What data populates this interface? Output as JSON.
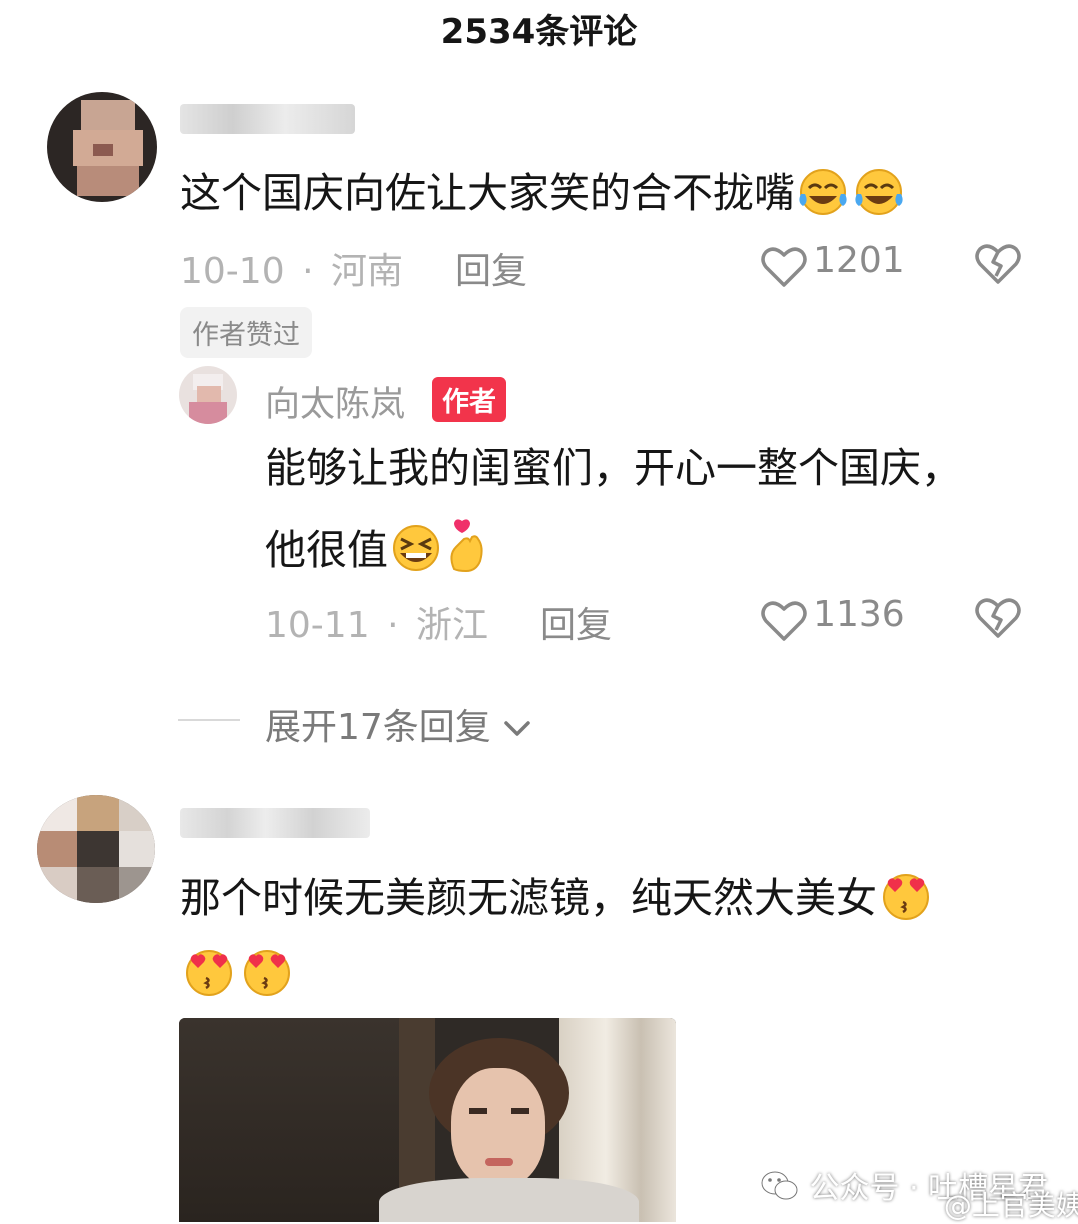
{
  "header": {
    "title": "2534条评论"
  },
  "comments": [
    {
      "text": "这个国庆向佐让大家笑的合不拢嘴",
      "date": "10-10",
      "sep": "·",
      "location": "河南",
      "reply_label": "回复",
      "likes": "1201",
      "author_liked_badge": "作者赞过",
      "emojis": [
        "laughing-tears-emoji",
        "laughing-tears-emoji"
      ]
    },
    {
      "text": "那个时候无美颜无滤镜，纯天然大美女",
      "emojis": [
        "heart-eyes-kiss-emoji",
        "heart-eyes-kiss-emoji",
        "heart-eyes-kiss-emoji"
      ]
    }
  ],
  "reply": {
    "author": "向太陈岚",
    "author_tag": "作者",
    "line1": "能够让我的闺蜜们，开心一整个国庆，",
    "line2": "他很值",
    "date": "10-11",
    "sep": "·",
    "location": "浙江",
    "reply_label": "回复",
    "likes": "1136",
    "emojis": [
      "grinning-squint-emoji",
      "finger-heart-emoji"
    ]
  },
  "expand": {
    "label": "展开17条回复"
  },
  "watermark": {
    "left": "公众号 · 吐槽星君",
    "right": "@上官美姨"
  },
  "colors": {
    "author_tag_bg": "#f2344b",
    "meta_gray": "#b3b3b3"
  }
}
